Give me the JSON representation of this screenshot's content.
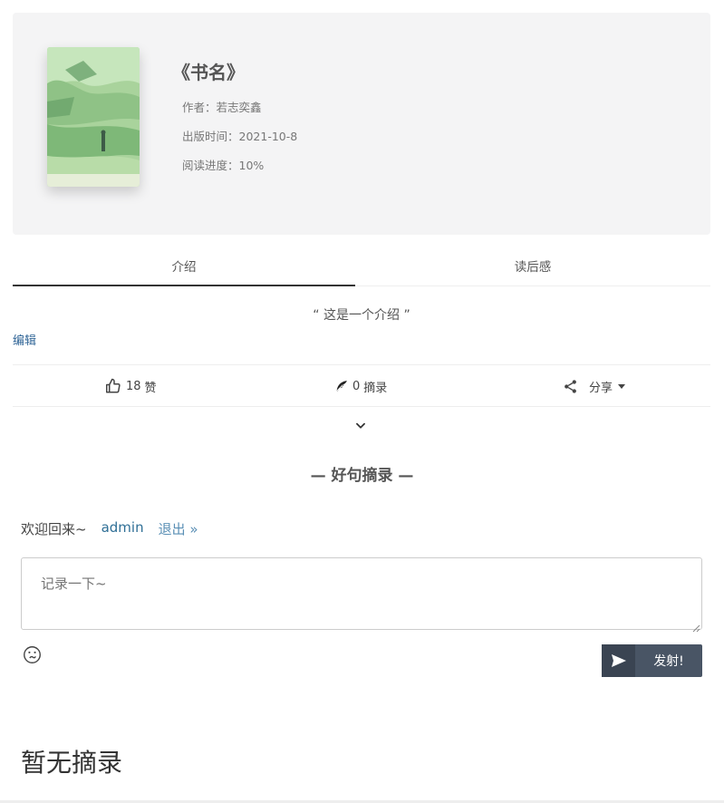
{
  "book": {
    "title": "《书名》",
    "author_label": "作者：",
    "author": "若志奕鑫",
    "published_label": "出版时间：",
    "published": "2021-10-8",
    "progress_label": "阅读进度：",
    "progress": "10%"
  },
  "tabs": [
    {
      "label": "介绍",
      "active": true
    },
    {
      "label": "读后感",
      "active": false
    }
  ],
  "intro": {
    "text": "“ 这是一个介绍 ”",
    "edit_label": "编辑"
  },
  "actions": {
    "like_count": "18",
    "like_label": "赞",
    "excerpt_count": "0",
    "excerpt_label": "摘录",
    "share_label": "分享"
  },
  "excerpts": {
    "section_title": "— 好句摘录 —",
    "welcome": "欢迎回来~",
    "username": "admin",
    "logout": "退出 »",
    "placeholder": "记录一下~",
    "send_label": "发射!",
    "empty_text": "暂无摘录"
  },
  "icons": {
    "like": "thumbs-up-icon",
    "excerpt": "feather-pen-icon",
    "share": "share-icon",
    "caret": "caret-down-icon",
    "expand": "chevron-down-icon",
    "emoji": "emoji-icon",
    "send": "paper-plane-icon"
  },
  "colors": {
    "header_bg": "#f4f4f5",
    "link": "#2f6496",
    "send_button": "#495565"
  }
}
